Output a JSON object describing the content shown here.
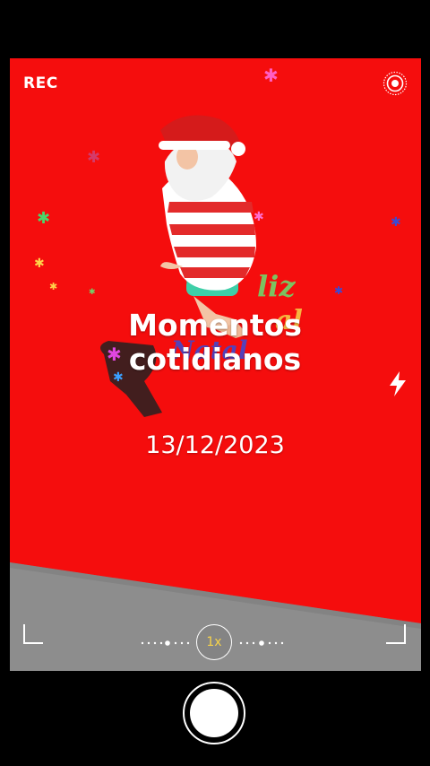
{
  "status": {
    "rec_label": "REC"
  },
  "overlay": {
    "title_line1": "Momentos",
    "title_line2": "cotidianos",
    "date": "13/12/2023"
  },
  "scene": {
    "sign_text_1": "liz",
    "sign_text_2": "al",
    "sign_text_3": "Natal"
  },
  "zoom": {
    "label": "1x"
  },
  "colors": {
    "background": "#f50d0d",
    "zoom_accent": "#f7d34a",
    "ground": "#8c8c8c"
  },
  "icons": [
    "live-photo-icon",
    "flash-icon",
    "shutter-button"
  ]
}
